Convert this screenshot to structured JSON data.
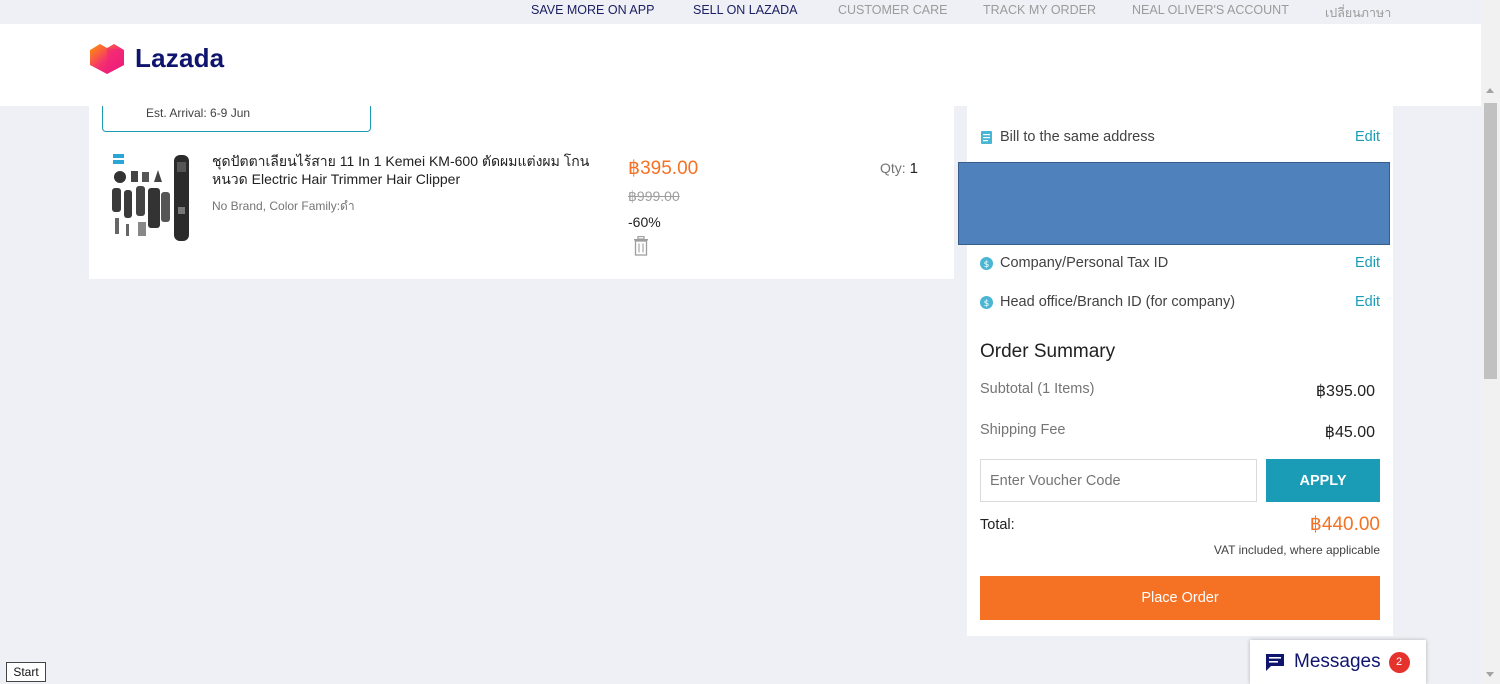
{
  "topbar": {
    "save_more": "SAVE MORE ON APP",
    "sell": "SELL ON LAZADA",
    "customer_care": "CUSTOMER CARE",
    "track_order": "TRACK MY ORDER",
    "account": "NEAL OLIVER'S ACCOUNT",
    "language": "เปลี่ยนภาษา"
  },
  "header": {
    "logo_text": "Lazada"
  },
  "shipment": {
    "est_arrival": "Est. Arrival: 6-9 Jun"
  },
  "product": {
    "title": "ชุดปัตตาเลียนไร้สาย 11 In 1 Kemei KM-600 ตัดผมแต่งผม โกนหนวด Electric Hair Trimmer Hair Clipper",
    "variant": "No Brand, Color Family:ดำ",
    "price": "฿395.00",
    "original_price": "฿999.00",
    "discount": "-60%",
    "qty_label": "Qty:",
    "qty_value": "1",
    "image_icon": "hair-clipper-set-image",
    "trash_icon": "trash-icon"
  },
  "billing": {
    "same_address": "Bill to the same address",
    "tax_id": "Company/Personal Tax ID",
    "branch_id": "Head office/Branch ID (for company)",
    "edit": "Edit"
  },
  "summary": {
    "title": "Order Summary",
    "subtotal_label": "Subtotal (1 Items)",
    "subtotal_value": "฿395.00",
    "shipping_label": "Shipping Fee",
    "shipping_value": "฿45.00",
    "voucher_placeholder": "Enter Voucher Code",
    "apply": "APPLY",
    "total_label": "Total:",
    "total_value": "฿440.00",
    "vat_note": "VAT included, where applicable",
    "place_order": "Place Order"
  },
  "messages": {
    "label": "Messages",
    "count": "2"
  },
  "taskbar": {
    "start": "Start"
  },
  "colors": {
    "accent_orange": "#f57224",
    "accent_teal": "#1a9cb7",
    "brand_navy": "#0f146d",
    "redaction_blue": "#4f81bd"
  }
}
